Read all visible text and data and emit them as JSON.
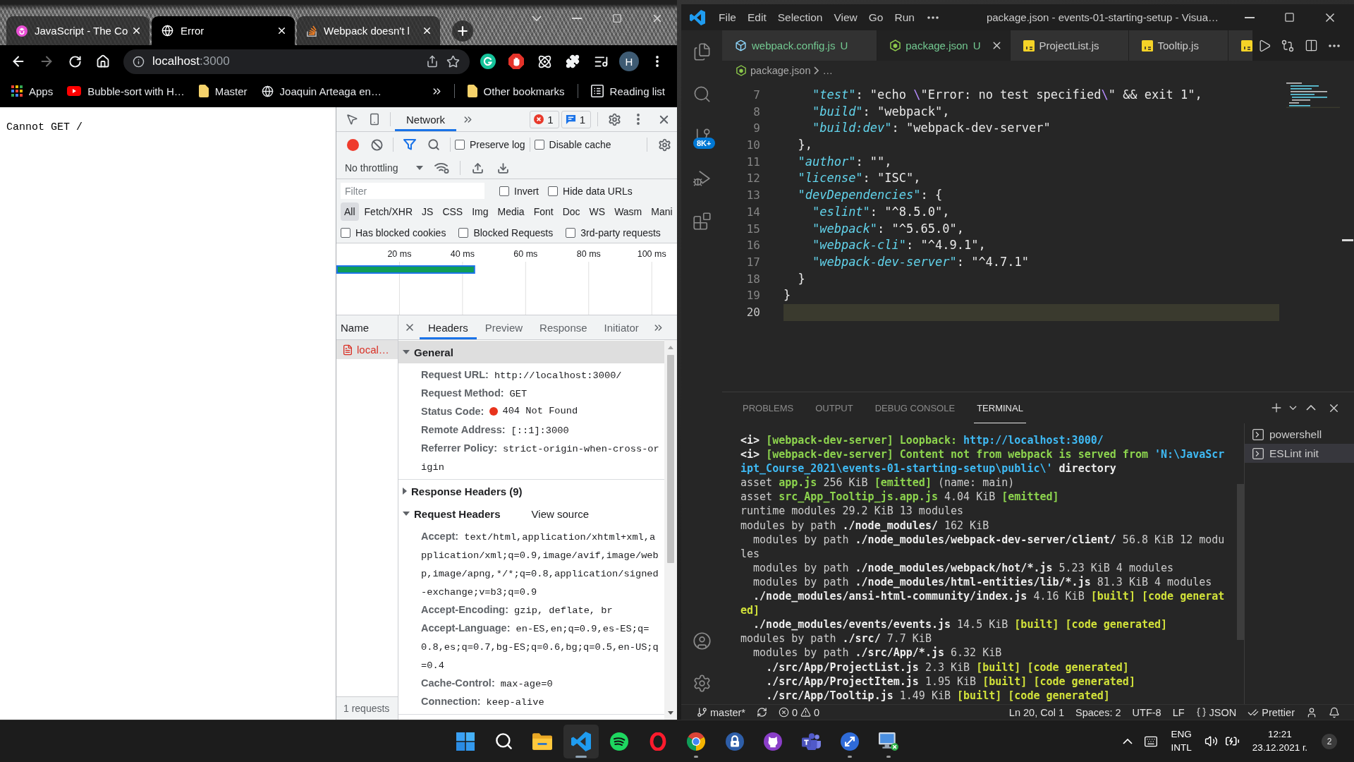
{
  "browser": {
    "tabs": [
      {
        "kind": "course",
        "title": "JavaScript - The Co",
        "selected": false
      },
      {
        "kind": "page",
        "title": "Error",
        "selected": true
      },
      {
        "kind": "forum",
        "title": "Webpack doesn't l",
        "selected": false
      }
    ],
    "forward_disabled": true,
    "address": {
      "host": "localhost",
      "port": ":3000"
    },
    "profile_initial": "H",
    "bookmarks": [
      {
        "kind": "apps",
        "label": "Apps"
      },
      {
        "kind": "video",
        "label": "Bubble-sort with H…"
      },
      {
        "kind": "folder",
        "label": "Master"
      },
      {
        "kind": "site",
        "label": "Joaquin Arteaga en…"
      }
    ],
    "other_bookmarks": "Other bookmarks",
    "reading_list": "Reading list",
    "page_text": "Cannot GET /"
  },
  "devtools": {
    "panel_tabs": [
      {
        "label": "Network",
        "selected": true
      }
    ],
    "error_count": "1",
    "message_count": "1",
    "recording": true,
    "options": [
      {
        "label": "Preserve log",
        "checked": false
      },
      {
        "label": "Disable cache",
        "checked": false
      }
    ],
    "throttling": "No throttling",
    "filter": {
      "placeholder": "Filter"
    },
    "filter_options": [
      {
        "label": "Invert",
        "checked": false
      },
      {
        "label": "Hide data URLs",
        "checked": false
      }
    ],
    "resource_types": [
      {
        "label": "All",
        "selected": true
      },
      {
        "label": "Fetch/XHR",
        "selected": false
      },
      {
        "label": "JS",
        "selected": false
      },
      {
        "label": "CSS",
        "selected": false
      },
      {
        "label": "Img",
        "selected": false
      },
      {
        "label": "Media",
        "selected": false
      },
      {
        "label": "Font",
        "selected": false
      },
      {
        "label": "Doc",
        "selected": false
      },
      {
        "label": "WS",
        "selected": false
      },
      {
        "label": "Wasm",
        "selected": false
      },
      {
        "label": "Mani",
        "selected": false
      }
    ],
    "request_filters": [
      {
        "label": "Has blocked cookies",
        "checked": false
      },
      {
        "label": "Blocked Requests",
        "checked": false
      },
      {
        "label": "3rd-party requests",
        "checked": false
      }
    ],
    "overview": {
      "chart_data": {
        "type": "bar",
        "orientation": "horizontal",
        "grid": true,
        "values": [
          44
        ],
        "xlim": [
          0,
          108
        ],
        "xticks": [
          {
            "value": 20,
            "label": "20 ms"
          },
          {
            "value": 40,
            "label": "40 ms"
          },
          {
            "value": 60,
            "label": "60 ms"
          },
          {
            "value": 80,
            "label": "80 ms"
          },
          {
            "value": 100,
            "label": "100 ms"
          }
        ]
      }
    },
    "requests": {
      "heading": "Name",
      "rows": [
        {
          "name": "local…",
          "selected": true
        }
      ],
      "summary": "1 requests"
    },
    "detail_tabs": [
      {
        "label": "Headers",
        "selected": true
      },
      {
        "label": "Preview",
        "selected": false
      },
      {
        "label": "Response",
        "selected": false
      },
      {
        "label": "Initiator",
        "selected": false
      }
    ],
    "sections": [
      {
        "title": "General",
        "expanded": true,
        "selected": true,
        "fields": [
          {
            "label": "Request URL:",
            "value": "http://localhost:3000/"
          },
          {
            "label": "Request Method:",
            "value": "GET"
          },
          {
            "label": "Status Code:",
            "value": "404 Not Found",
            "color": "#e8331c"
          },
          {
            "label": "Remote Address:",
            "value": "[::1]:3000"
          },
          {
            "label": "Referrer Policy:",
            "value": "strict-origin-when-cross-origin"
          }
        ]
      },
      {
        "title": "Response Headers (9)",
        "expanded": false,
        "selected": false
      },
      {
        "title": "Request Headers",
        "expanded": true,
        "selected": false,
        "action": "View source",
        "fields": [
          {
            "label": "Accept:",
            "value": "text/html,application/xhtml+xml,application/xml;q=0.9,image/avif,image/webp,image/apng,*/*;q=0.8,application/signed-exchange;v=b3;q=0.9"
          },
          {
            "label": "Accept-Encoding:",
            "value": "gzip, deflate, br"
          },
          {
            "label": "Accept-Language:",
            "value": "en-ES,en;q=0.9,es-ES;q=0.8,es;q=0.7,bg-ES;q=0.6,bg;q=0.5,en-US;q=0.4"
          },
          {
            "label": "Cache-Control:",
            "value": "max-age=0"
          },
          {
            "label": "Connection:",
            "value": "keep-alive"
          }
        ]
      }
    ]
  },
  "vscode": {
    "menu": [
      "File",
      "Edit",
      "Selection",
      "View",
      "Go",
      "Run"
    ],
    "title": "package.json - events-01-starting-setup - Visua…",
    "activity": [
      {
        "kind": "files"
      },
      {
        "kind": "search"
      },
      {
        "kind": "source-control",
        "badge": "8K+"
      },
      {
        "kind": "run"
      },
      {
        "kind": "extensions"
      }
    ],
    "tabs": [
      {
        "kind": "config",
        "label": "webpack.config.js",
        "status": "U",
        "selected": false
      },
      {
        "kind": "json",
        "label": "package.json",
        "status": "U",
        "selected": true
      },
      {
        "kind": "js",
        "label": "ProjectList.js",
        "selected": false
      },
      {
        "kind": "js",
        "label": "Tooltip.js",
        "selected": false
      },
      {
        "kind": "js",
        "selected": false
      }
    ],
    "breadcrumb": {
      "file": "package.json",
      "rest": "…"
    },
    "lines": [
      {
        "number": "7",
        "current": false,
        "tokens": [
          {
            "kind": "key",
            "text": "    \"test\""
          },
          {
            "kind": "punct",
            "text": ": "
          },
          {
            "kind": "string",
            "text": "\"echo "
          },
          {
            "kind": "escape",
            "text": "\\"
          },
          {
            "kind": "string",
            "text": "\"Error: no test specified"
          },
          {
            "kind": "escape",
            "text": "\\"
          },
          {
            "kind": "string",
            "text": "\" && exit 1\""
          },
          {
            "kind": "punct",
            "text": ","
          }
        ]
      },
      {
        "number": "8",
        "current": false,
        "tokens": [
          {
            "kind": "key",
            "text": "    \"build\""
          },
          {
            "kind": "punct",
            "text": ": "
          },
          {
            "kind": "string",
            "text": "\"webpack\""
          },
          {
            "kind": "punct",
            "text": ","
          }
        ]
      },
      {
        "number": "9",
        "current": false,
        "tokens": [
          {
            "kind": "key",
            "text": "    \"build:dev\""
          },
          {
            "kind": "punct",
            "text": ": "
          },
          {
            "kind": "string",
            "text": "\"webpack-dev-server\""
          }
        ]
      },
      {
        "number": "10",
        "current": false,
        "tokens": [
          {
            "kind": "punct",
            "text": "  },"
          }
        ]
      },
      {
        "number": "11",
        "current": false,
        "tokens": [
          {
            "kind": "key",
            "text": "  \"author\""
          },
          {
            "kind": "punct",
            "text": ": "
          },
          {
            "kind": "string",
            "text": "\"\""
          },
          {
            "kind": "punct",
            "text": ","
          }
        ]
      },
      {
        "number": "12",
        "current": false,
        "tokens": [
          {
            "kind": "key",
            "text": "  \"license\""
          },
          {
            "kind": "punct",
            "text": ": "
          },
          {
            "kind": "string",
            "text": "\"ISC\""
          },
          {
            "kind": "punct",
            "text": ","
          }
        ]
      },
      {
        "number": "13",
        "current": false,
        "tokens": [
          {
            "kind": "key",
            "text": "  \"devDependencies\""
          },
          {
            "kind": "punct",
            "text": ": {"
          }
        ]
      },
      {
        "number": "14",
        "current": false,
        "tokens": [
          {
            "kind": "key",
            "text": "    \"eslint\""
          },
          {
            "kind": "punct",
            "text": ": "
          },
          {
            "kind": "string",
            "text": "\"^8.5.0\""
          },
          {
            "kind": "punct",
            "text": ","
          }
        ]
      },
      {
        "number": "15",
        "current": false,
        "tokens": [
          {
            "kind": "key",
            "text": "    \"webpack\""
          },
          {
            "kind": "punct",
            "text": ": "
          },
          {
            "kind": "string",
            "text": "\"^5.65.0\""
          },
          {
            "kind": "punct",
            "text": ","
          }
        ]
      },
      {
        "number": "16",
        "current": false,
        "tokens": [
          {
            "kind": "key",
            "text": "    \"webpack-cli\""
          },
          {
            "kind": "punct",
            "text": ": "
          },
          {
            "kind": "string",
            "text": "\"^4.9.1\""
          },
          {
            "kind": "punct",
            "text": ","
          }
        ]
      },
      {
        "number": "17",
        "current": false,
        "tokens": [
          {
            "kind": "key",
            "text": "    \"webpack-dev-server\""
          },
          {
            "kind": "punct",
            "text": ": "
          },
          {
            "kind": "string",
            "text": "\"^4.7.1\""
          }
        ]
      },
      {
        "number": "18",
        "current": false,
        "tokens": [
          {
            "kind": "punct",
            "text": "  }"
          }
        ]
      },
      {
        "number": "19",
        "current": false,
        "tokens": [
          {
            "kind": "punct",
            "text": "}"
          }
        ]
      },
      {
        "number": "20",
        "current": true
      }
    ],
    "panel_tabs": [
      {
        "label": "PROBLEMS",
        "selected": false
      },
      {
        "label": "OUTPUT",
        "selected": false
      },
      {
        "label": "DEBUG CONSOLE",
        "selected": false
      },
      {
        "label": "TERMINAL",
        "selected": true
      }
    ],
    "terminal_lines": [
      {
        "segments": [
          {
            "kind": "bold",
            "text": "<i> "
          },
          {
            "kind": "green",
            "text": "[webpack-dev-server] Loopback: "
          },
          {
            "kind": "cyan",
            "text": "http://localhost:3000/"
          }
        ]
      },
      {
        "segments": [
          {
            "kind": "bold",
            "text": "<i> "
          },
          {
            "kind": "green",
            "text": "[webpack-dev-server] Content not from webpack is served from "
          },
          {
            "kind": "cyan",
            "text": "'N:\\JavaScr"
          }
        ]
      },
      {
        "segments": [
          {
            "kind": "cyan",
            "text": "ipt_Course_2021\\events-01-starting-setup\\public\\'"
          },
          {
            "kind": "bold",
            "text": " directory"
          }
        ]
      },
      {
        "segments": [
          {
            "kind": "plain",
            "text": "asset "
          },
          {
            "kind": "green",
            "text": "app.js"
          },
          {
            "kind": "plain",
            "text": " 256 KiB "
          },
          {
            "kind": "green",
            "text": "[emitted]"
          },
          {
            "kind": "plain",
            "text": " (name: main)"
          }
        ]
      },
      {
        "segments": [
          {
            "kind": "plain",
            "text": "asset "
          },
          {
            "kind": "green",
            "text": "src_App_Tooltip_js.app.js"
          },
          {
            "kind": "plain",
            "text": " 4.04 KiB "
          },
          {
            "kind": "green",
            "text": "[emitted]"
          }
        ]
      },
      {
        "segments": [
          {
            "kind": "plain",
            "text": "runtime modules 29.2 KiB 13 modules"
          }
        ]
      },
      {
        "segments": [
          {
            "kind": "plain",
            "text": "modules by path "
          },
          {
            "kind": "bold",
            "text": "./node_modules/"
          },
          {
            "kind": "plain",
            "text": " 162 KiB"
          }
        ]
      },
      {
        "segments": [
          {
            "kind": "plain",
            "text": "  modules by path "
          },
          {
            "kind": "bold",
            "text": "./node_modules/webpack-dev-server/client/"
          },
          {
            "kind": "plain",
            "text": " 56.8 KiB 12 modu"
          }
        ]
      },
      {
        "segments": [
          {
            "kind": "plain",
            "text": "les"
          }
        ]
      },
      {
        "segments": [
          {
            "kind": "plain",
            "text": "  modules by path "
          },
          {
            "kind": "bold",
            "text": "./node_modules/webpack/hot/*.js"
          },
          {
            "kind": "plain",
            "text": " 5.23 KiB 4 modules"
          }
        ]
      },
      {
        "segments": [
          {
            "kind": "plain",
            "text": "  modules by path "
          },
          {
            "kind": "bold",
            "text": "./node_modules/html-entities/lib/*.js"
          },
          {
            "kind": "plain",
            "text": " 81.3 KiB 4 modules"
          }
        ]
      },
      {
        "segments": [
          {
            "kind": "bold",
            "text": "  ./node_modules/ansi-html-community/index.js"
          },
          {
            "kind": "plain",
            "text": " 4.16 KiB "
          },
          {
            "kind": "yellow",
            "text": "[built] [code generat"
          }
        ]
      },
      {
        "segments": [
          {
            "kind": "yellow",
            "text": "ed]"
          }
        ]
      },
      {
        "segments": [
          {
            "kind": "bold",
            "text": "  ./node_modules/events/events.js"
          },
          {
            "kind": "plain",
            "text": " 14.5 KiB "
          },
          {
            "kind": "yellow",
            "text": "[built] [code generated]"
          }
        ]
      },
      {
        "segments": [
          {
            "kind": "plain",
            "text": "modules by path "
          },
          {
            "kind": "bold",
            "text": "./src/"
          },
          {
            "kind": "plain",
            "text": " 7.7 KiB"
          }
        ]
      },
      {
        "segments": [
          {
            "kind": "plain",
            "text": "  modules by path "
          },
          {
            "kind": "bold",
            "text": "./src/App/*.js"
          },
          {
            "kind": "plain",
            "text": " 6.32 KiB"
          }
        ]
      },
      {
        "segments": [
          {
            "kind": "bold",
            "text": "    ./src/App/ProjectList.js"
          },
          {
            "kind": "plain",
            "text": " 2.3 KiB "
          },
          {
            "kind": "yellow",
            "text": "[built] [code generated]"
          }
        ]
      },
      {
        "segments": [
          {
            "kind": "bold",
            "text": "    ./src/App/ProjectItem.js"
          },
          {
            "kind": "plain",
            "text": " 1.95 KiB "
          },
          {
            "kind": "yellow",
            "text": "[built] [code generated]"
          }
        ]
      },
      {
        "segments": [
          {
            "kind": "bold",
            "text": "    ./src/App/Tooltip.js"
          },
          {
            "kind": "plain",
            "text": " 1.49 KiB "
          },
          {
            "kind": "yellow",
            "text": "[built] [code generated]"
          }
        ]
      }
    ],
    "terminals": [
      {
        "label": "powershell",
        "selected": false
      },
      {
        "label": "ESLint init",
        "selected": true
      }
    ],
    "status_bar": {
      "branch": "master*",
      "errors": "0",
      "warnings": "0",
      "items": [
        "Ln 20, Col 1",
        "Spaces: 2",
        "UTF-8",
        "LF"
      ],
      "language": "JSON",
      "formatter": "Prettier"
    }
  },
  "taskbar": {
    "apps": [
      {
        "kind": "start",
        "running": false,
        "selected": false
      },
      {
        "kind": "search",
        "running": false,
        "selected": false
      },
      {
        "kind": "files",
        "running": false,
        "selected": false
      },
      {
        "kind": "code",
        "running": true,
        "selected": true
      },
      {
        "kind": "music",
        "running": false,
        "selected": false
      },
      {
        "kind": "ring",
        "running": false,
        "selected": false
      },
      {
        "kind": "browser",
        "running": true,
        "selected": false
      },
      {
        "kind": "lock",
        "running": false,
        "selected": false
      },
      {
        "kind": "cat",
        "running": false,
        "selected": false
      },
      {
        "kind": "chat",
        "running": false,
        "selected": false
      },
      {
        "kind": "remote",
        "running": true,
        "selected": false
      },
      {
        "kind": "desktop",
        "running": true,
        "selected": false
      }
    ],
    "language": {
      "primary": "ENG",
      "secondary": "INTL"
    },
    "time": "12:21",
    "date": "23.12.2021 г.",
    "notification_count": "2"
  }
}
